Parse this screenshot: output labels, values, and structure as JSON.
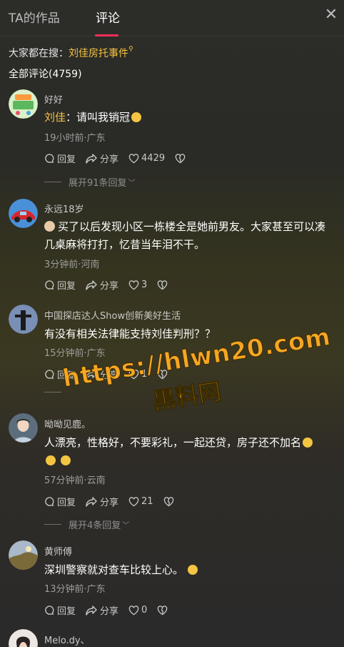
{
  "tabs": [
    {
      "label": "TA的作品"
    },
    {
      "label": "评论"
    }
  ],
  "search": {
    "prefix": "大家都在搜：",
    "term": "刘佳房托事件"
  },
  "comment_count": "全部评论(4759)",
  "action_labels": {
    "reply": "回复",
    "share": "分享"
  },
  "comments": [
    {
      "name": "好好",
      "mention": "刘佳",
      "text": "：请叫我销冠",
      "meta": "19小时前·广东",
      "likes": "4429",
      "expand": "展开91条回复"
    },
    {
      "name": "永远18岁",
      "text_line1": "买了以后发现小区一栋楼全是她前男友。大家甚至可以凑",
      "text_line2": "几桌麻将打打，忆昔当年泪不干。",
      "meta": "3分钟前·河南",
      "likes": "3"
    },
    {
      "name": "中国探店达人Show创新美好生活",
      "text": "有没有相关法律能支持刘佳判刑？？",
      "meta": "15分钟前·广东",
      "likes": "1"
    },
    {
      "name": "呦呦见鹿。",
      "text_line1": "人漂亮，性格好，不要彩礼，一起还贷，房子还不加名",
      "meta": "57分钟前·云南",
      "likes": "21",
      "expand": "展开4条回复"
    },
    {
      "name": "黄师傅",
      "text": "深圳警察就对查车比较上心。",
      "meta": "13分钟前·广东",
      "likes": "0"
    },
    {
      "name": "Melo.dy、"
    }
  ],
  "watermark": {
    "url": "https://hlwn20.com",
    "name": "黑料网"
  },
  "colors": {
    "accent_red": "#fe2c55",
    "mention_gold": "#f5c242",
    "watermark_orange": "#f6a623"
  }
}
